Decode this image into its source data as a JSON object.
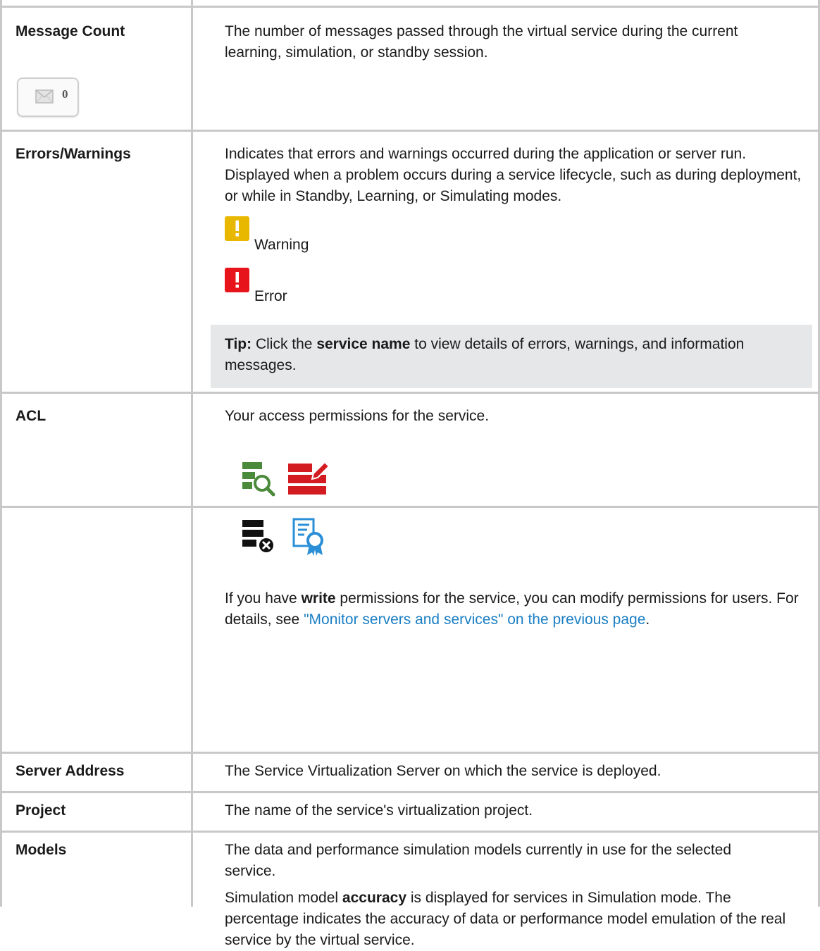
{
  "rows": [
    {
      "label": "Message Count",
      "description": "The number of messages passed through the virtual service during the current learning, simulation, or standby session.",
      "badge": {
        "icon": "envelope-icon",
        "count": "0"
      }
    },
    {
      "label": "Errors/Warnings",
      "description": "Indicates that errors and warnings occurred during the application or server run. Displayed when a problem occurs during a service lifecycle, such as during deployment, or while in Standby, Learning, or Simulating modes.",
      "statuses": [
        {
          "icon": "warning-icon",
          "label": "Warning",
          "color": "#e8b800"
        },
        {
          "icon": "error-icon",
          "label": "Error",
          "color": "#e8141b"
        }
      ],
      "tip": {
        "prefix": "Tip:",
        "text_before": " Click the ",
        "bold": "service name",
        "text_after": " to view details of errors, warnings, and information messages."
      }
    },
    {
      "label": "ACL",
      "description": "Your access permissions for the service.",
      "permission_icons": [
        "server-read-icon",
        "server-write-icon",
        "server-no-access-icon",
        "owner-certificate-icon"
      ],
      "note": {
        "before": "If you have ",
        "bold": "write",
        "middle": " permissions for the service, you can modify permissions for users. For details, see ",
        "link": "\"Monitor servers and services\" on the previous page",
        "after": "."
      }
    },
    {
      "label": "Server Address",
      "description": "The Service Virtualization Server on which the service is deployed."
    },
    {
      "label": "Project",
      "description": "The name of the service's virtualization project."
    },
    {
      "label": "Models",
      "description": "The data and performance simulation models currently in use for the selected service.",
      "extra": {
        "before": "Simulation model ",
        "bold": "accuracy",
        "after": " is displayed for services in Simulation mode. The percentage indicates the accuracy of data or performance model emulation of the real service by the virtual service."
      }
    }
  ],
  "colors": {
    "border": "#c8c8c8",
    "tip_bg": "#e6e7e8",
    "link": "#1b7fc4",
    "read_green": "#4a8a3a",
    "write_red": "#d31b22",
    "cert_blue": "#2a8fd6"
  }
}
